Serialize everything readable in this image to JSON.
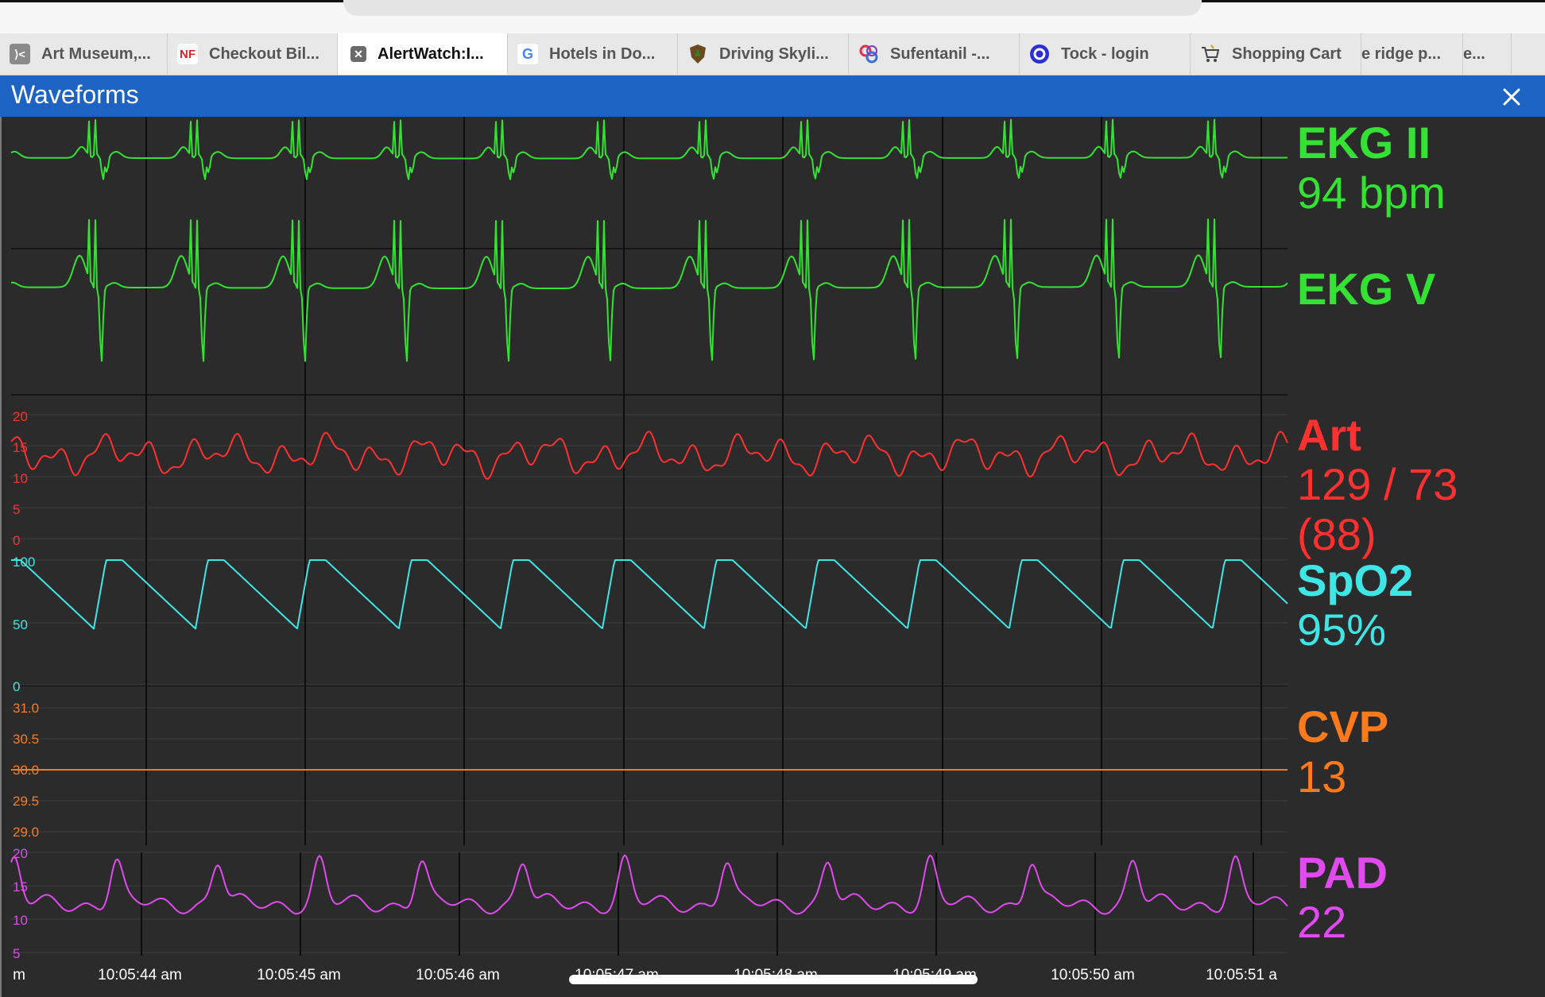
{
  "browser": {
    "tabs": [
      {
        "title": "Art Museum,...",
        "icon": "museum-icon",
        "active": false
      },
      {
        "title": "Checkout Bil...",
        "icon": "nf-icon",
        "active": false
      },
      {
        "title": "AlertWatch:I...",
        "icon": "close-tab-icon",
        "active": true
      },
      {
        "title": "Hotels in Do...",
        "icon": "google-icon",
        "active": false
      },
      {
        "title": "Driving Skyli...",
        "icon": "shield-icon",
        "active": false
      },
      {
        "title": "Sufentanil -...",
        "icon": "knot-icon",
        "active": false
      },
      {
        "title": "Tock - login",
        "icon": "tock-icon",
        "active": false
      },
      {
        "title": "Shopping Cart",
        "icon": "cart-icon",
        "active": false
      },
      {
        "title": "e ridge p...",
        "icon": "",
        "active": false
      },
      {
        "title": "e...",
        "icon": "",
        "active": false
      }
    ]
  },
  "header": {
    "title": "Waveforms",
    "close_icon": "close-icon"
  },
  "colors": {
    "ekg": "#33e233",
    "art": "#ff3030",
    "spo2": "#3ee6e6",
    "cvp": "#ff7a1a",
    "pad": "#e04aee",
    "background": "#2b2b2b",
    "header": "#1c63c4"
  },
  "vitals": {
    "ekg2": {
      "name": "EKG II",
      "value": "94 bpm"
    },
    "ekgv": {
      "name": "EKG V"
    },
    "art": {
      "name": "Art",
      "value": "129 / 73",
      "mean": "(88)"
    },
    "spo2": {
      "name": "SpO2",
      "value": "95%"
    },
    "cvp": {
      "name": "CVP",
      "value": "13"
    },
    "pad": {
      "name": "PAD",
      "value": "22"
    }
  },
  "axes": {
    "art": [
      "20",
      "15",
      "10",
      "5",
      "0"
    ],
    "spo2": [
      "100",
      "50",
      "0"
    ],
    "cvp": [
      "31.0",
      "30.5",
      "30.0",
      "29.5",
      "29.0"
    ],
    "pad": [
      "20",
      "15",
      "10",
      "5"
    ]
  },
  "time_axis": [
    "m",
    "10:05:44 am",
    "10:05:45 am",
    "10:05:46 am",
    "10:05:47 am",
    "10:05:48 am",
    "10:05:49 am",
    "10:05:50 am",
    "10:05:51 a"
  ],
  "heart_rate_bpm": 94,
  "cvp_trace_value": 30.0
}
